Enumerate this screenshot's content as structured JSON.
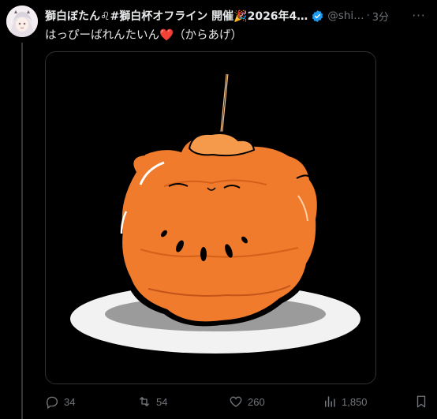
{
  "post": {
    "display_name": "獅白ぼたん♌#獅白杯オフライン 開催🎉2026年4…",
    "handle": "@shi…",
    "separator": "·",
    "time": "3分",
    "text_main": "はっぴーばれんたいん",
    "text_heart": "❤️",
    "text_suffix": "（からあげ）",
    "more_label": "···"
  },
  "actions": {
    "reply_count": "34",
    "repost_count": "54",
    "like_count": "260",
    "view_count": "1,850"
  },
  "icons": {
    "verified": "verified-badge-icon",
    "reply": "reply-icon",
    "repost": "repost-icon",
    "like": "like-icon",
    "views": "views-icon",
    "bookmark": "bookmark-icon"
  },
  "colors": {
    "background": "#000000",
    "text": "#e7e9ea",
    "muted": "#71767b",
    "verified": "#1d9bf0",
    "karaage": "#f07b2c"
  }
}
